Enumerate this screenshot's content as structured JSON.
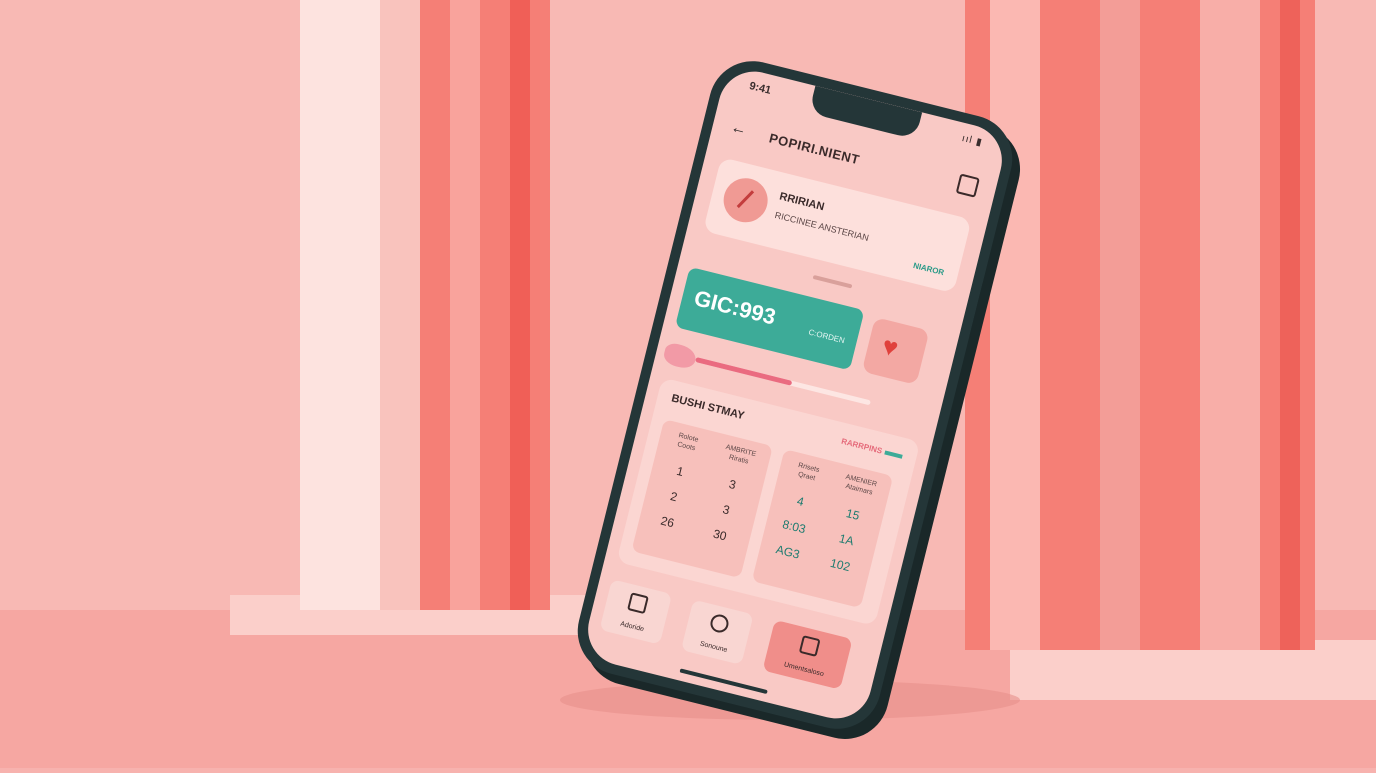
{
  "status_bar": {
    "carrier": "9:41",
    "signal": "ııl ▮"
  },
  "header": {
    "title": "POPIRI.NIENT"
  },
  "profile": {
    "name": "RRIRIAN",
    "subtitle": "RICCINEE ANSTERIAN",
    "tag": "NIAROR"
  },
  "balance": {
    "amount": "GIC:993",
    "label": "C:ORDEN"
  },
  "progress": {
    "fraction": 0.55
  },
  "stats": {
    "title": "BUSHI STMAY",
    "link_label": "RARRPINS",
    "left_table": {
      "col_a": {
        "header": "Rolote\nCoots",
        "values": [
          "1",
          "2",
          "26"
        ]
      },
      "col_b": {
        "header": "AMBRITE\nRiratis",
        "values": [
          "3",
          "3",
          "30"
        ]
      }
    },
    "right_table": {
      "col_a": {
        "header": "Rrisets\nQraet",
        "values": [
          "4",
          "8:03",
          "AG3"
        ]
      },
      "col_b": {
        "header": "AMENIER\nAtaimars",
        "values": [
          "15",
          "1A",
          "102"
        ]
      }
    }
  },
  "nav": {
    "items": [
      {
        "label": "Adoride",
        "icon": "square-icon"
      },
      {
        "label": "Sonoune",
        "icon": "bell-icon"
      },
      {
        "label": "Umentsaloso",
        "icon": "bag-icon"
      }
    ]
  },
  "colors": {
    "accent_teal": "#3dab98",
    "accent_pink": "#ea6b80",
    "heart": "#e0413c"
  }
}
